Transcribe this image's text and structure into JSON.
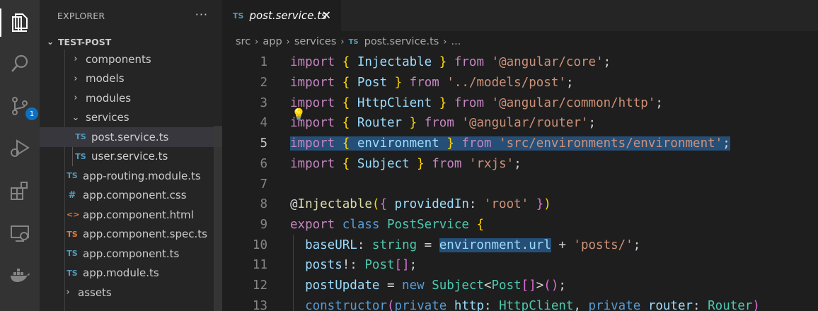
{
  "activity_bar": {
    "icons": [
      "explorer-icon",
      "search-icon",
      "source-control-icon",
      "run-debug-icon",
      "extensions-icon",
      "remote-explorer-icon",
      "docker-icon"
    ],
    "source_control_badge": "1"
  },
  "sidebar": {
    "title": "EXPLORER",
    "more_actions": "···",
    "project": "TEST-POST",
    "items": [
      {
        "label": "components",
        "type": "folder",
        "expanded": false
      },
      {
        "label": "models",
        "type": "folder",
        "expanded": false
      },
      {
        "label": "modules",
        "type": "folder",
        "expanded": false
      },
      {
        "label": "services",
        "type": "folder",
        "expanded": true
      },
      {
        "label": "post.service.ts",
        "type": "ts",
        "icon": "TS",
        "selected": true
      },
      {
        "label": "user.service.ts",
        "type": "ts",
        "icon": "TS"
      },
      {
        "label": "app-routing.module.ts",
        "type": "ts",
        "icon": "TS"
      },
      {
        "label": "app.component.css",
        "type": "css",
        "icon": "#"
      },
      {
        "label": "app.component.html",
        "type": "html",
        "icon": "<>"
      },
      {
        "label": "app.component.spec.ts",
        "type": "spec",
        "icon": "TS"
      },
      {
        "label": "app.component.ts",
        "type": "ts",
        "icon": "TS"
      },
      {
        "label": "app.module.ts",
        "type": "ts",
        "icon": "TS"
      },
      {
        "label": "assets",
        "type": "folder",
        "expanded": false
      }
    ]
  },
  "tabs": [
    {
      "icon": "TS",
      "label": "post.service.ts",
      "close": "✕"
    }
  ],
  "breadcrumb": {
    "parts": [
      "src",
      "app",
      "services"
    ],
    "file_icon": "TS",
    "file": "post.service.ts",
    "ellipsis": "..."
  },
  "editor": {
    "current_line": 5,
    "line_numbers": [
      "1",
      "2",
      "3",
      "4",
      "5",
      "6",
      "7",
      "8",
      "9",
      "10",
      "11",
      "12",
      "13"
    ]
  },
  "colors": {
    "keyword": "#569cd6",
    "control": "#c586c0",
    "string": "#ce9178",
    "type": "#4ec9b0",
    "variable": "#9cdcfe",
    "bracket": "#ffd700",
    "selection": "#264f78"
  }
}
